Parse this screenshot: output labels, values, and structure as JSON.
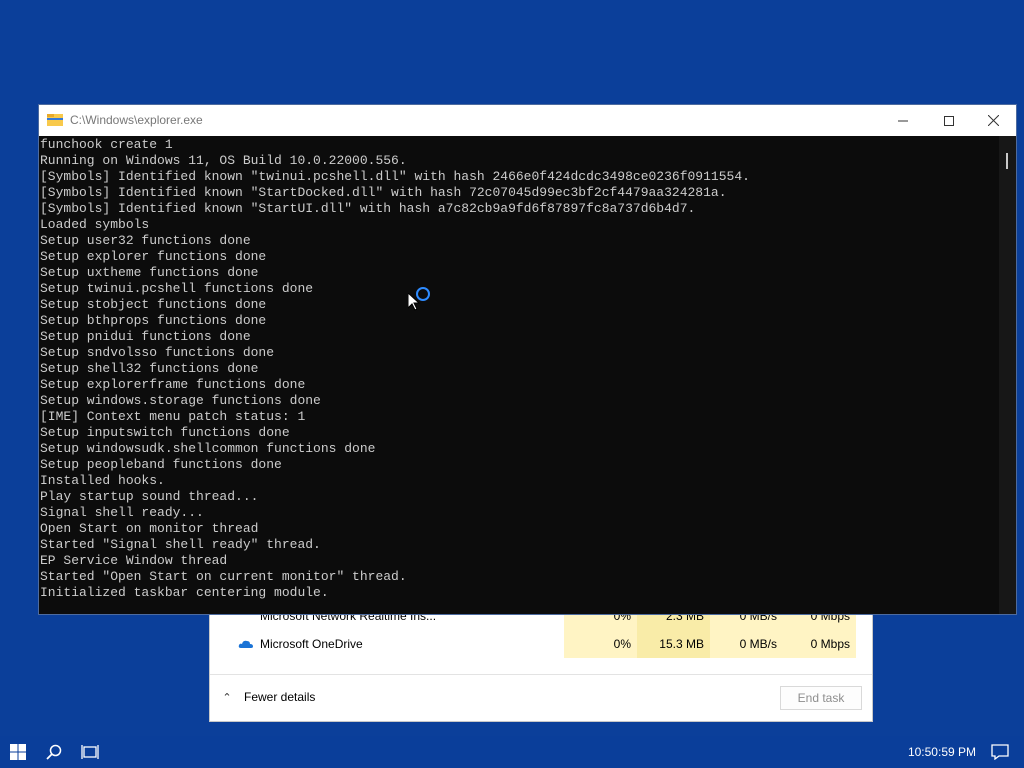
{
  "console": {
    "title": "C:\\Windows\\explorer.exe",
    "lines": [
      "funchook create 1",
      "Running on Windows 11, OS Build 10.0.22000.556.",
      "[Symbols] Identified known \"twinui.pcshell.dll\" with hash 2466e0f424dcdc3498ce0236f0911554.",
      "[Symbols] Identified known \"StartDocked.dll\" with hash 72c07045d99ec3bf2cf4479aa324281a.",
      "[Symbols] Identified known \"StartUI.dll\" with hash a7c82cb9a9fd6f87897fc8a737d6b4d7.",
      "Loaded symbols",
      "Setup user32 functions done",
      "Setup explorer functions done",
      "Setup uxtheme functions done",
      "Setup twinui.pcshell functions done",
      "Setup stobject functions done",
      "Setup bthprops functions done",
      "Setup pnidui functions done",
      "Setup sndvolsso functions done",
      "Setup shell32 functions done",
      "Setup explorerframe functions done",
      "Setup windows.storage functions done",
      "[IME] Context menu patch status: 1",
      "Setup inputswitch functions done",
      "Setup windowsudk.shellcommon functions done",
      "Setup peopleband functions done",
      "Installed hooks.",
      "Play startup sound thread...",
      "Signal shell ready...",
      "Open Start on monitor thread",
      "Started \"Signal shell ready\" thread.",
      "EP Service Window thread",
      "Started \"Open Start on current monitor\" thread.",
      "Initialized taskbar centering module."
    ]
  },
  "task_manager": {
    "rows": [
      {
        "name": "Microsoft Network Realtime Ins...",
        "cpu": "0%",
        "memory": "2.3 MB",
        "disk": "0 MB/s",
        "network": "0 Mbps"
      },
      {
        "name": "Microsoft OneDrive",
        "cpu": "0%",
        "memory": "15.3 MB",
        "disk": "0 MB/s",
        "network": "0 Mbps"
      }
    ],
    "fewer_details": "Fewer details",
    "end_task": "End task"
  },
  "taskbar": {
    "clock": "10:50:59 PM",
    "icons": [
      "windows-start-icon",
      "search-icon",
      "task-view-icon",
      "notification-icon"
    ]
  },
  "colors": {
    "desktop": "#0b3f9a",
    "console_bg": "#0c0c0c",
    "console_text": "#cccccc",
    "accent": "#2e8bff"
  }
}
